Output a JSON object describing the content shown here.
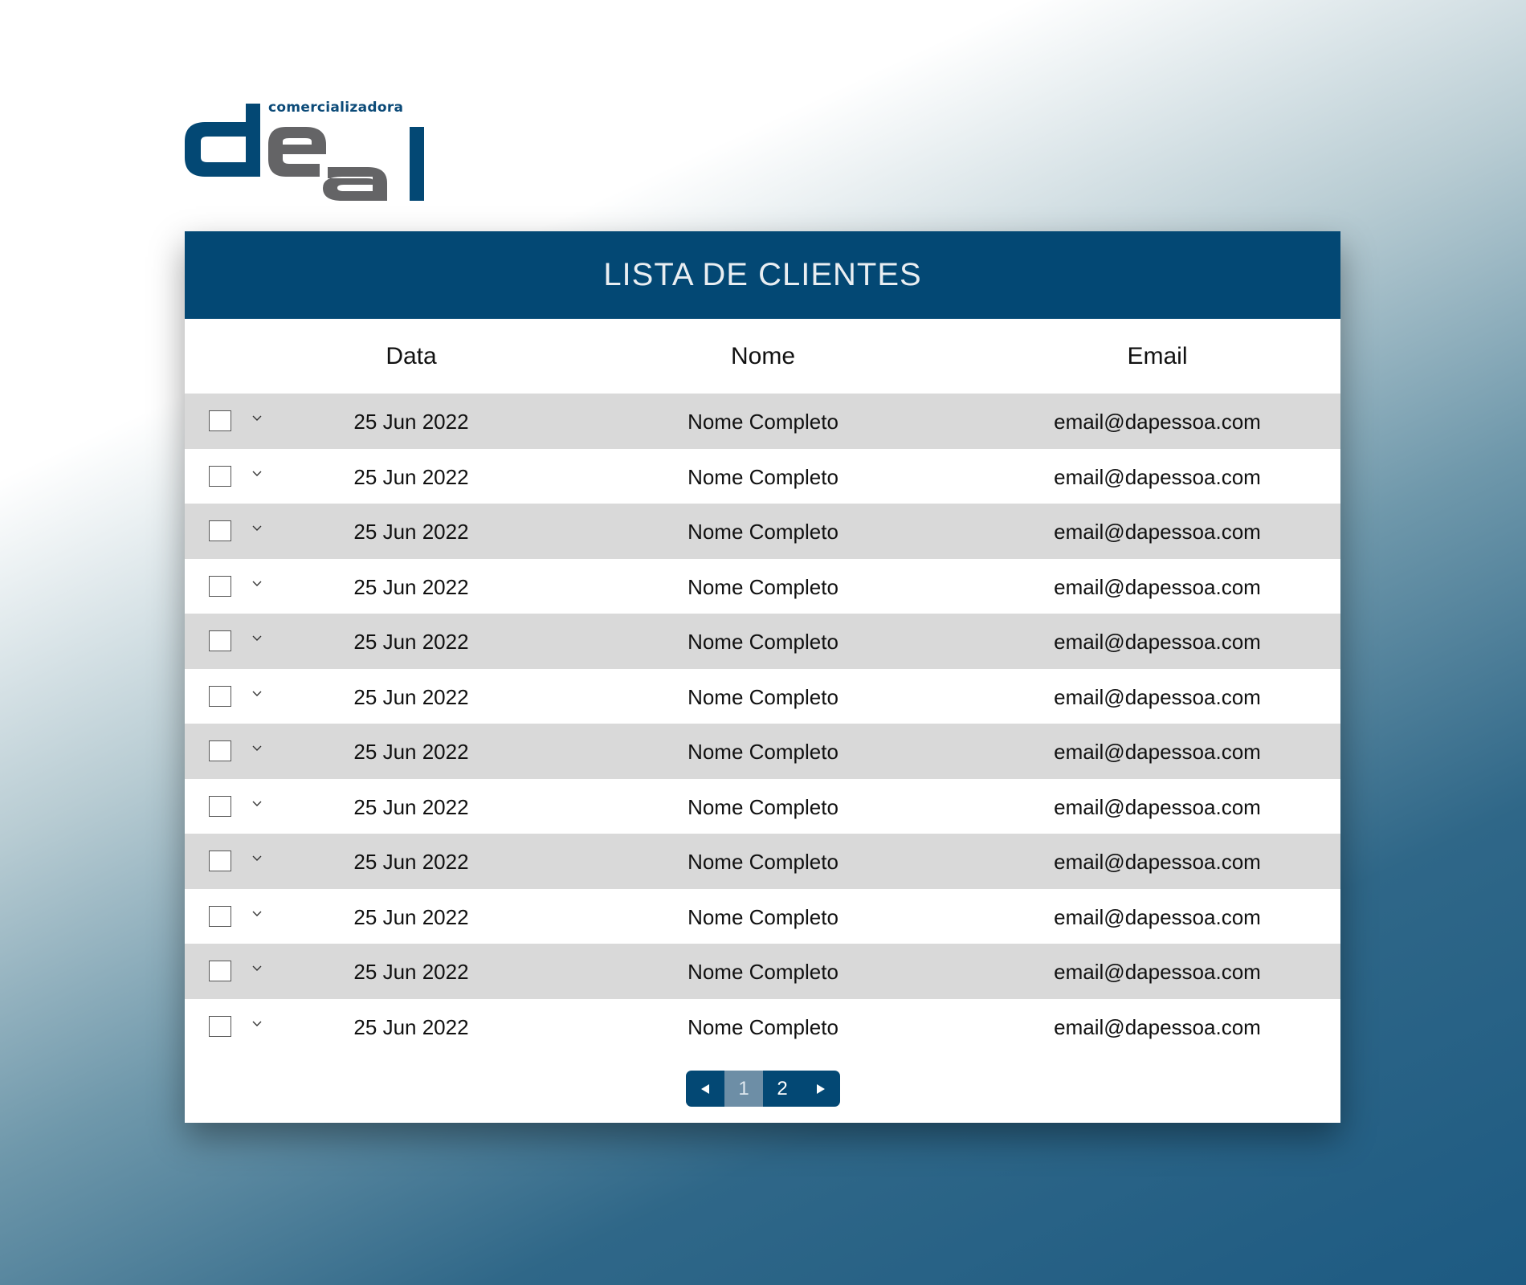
{
  "brand": {
    "tagline": "comercializadora",
    "wordmark": "deal",
    "colors": {
      "blue": "#034874",
      "gray": "#646466"
    }
  },
  "table": {
    "title": "LISTA DE CLIENTES",
    "columns": {
      "data": "Data",
      "nome": "Nome",
      "email": "Email"
    },
    "rows": [
      {
        "data": "25 Jun 2022",
        "nome": "Nome Completo",
        "email": "email@dapessoa.com",
        "checked": false
      },
      {
        "data": "25 Jun 2022",
        "nome": "Nome Completo",
        "email": "email@dapessoa.com",
        "checked": false
      },
      {
        "data": "25 Jun 2022",
        "nome": "Nome Completo",
        "email": "email@dapessoa.com",
        "checked": false
      },
      {
        "data": "25 Jun 2022",
        "nome": "Nome Completo",
        "email": "email@dapessoa.com",
        "checked": false
      },
      {
        "data": "25 Jun 2022",
        "nome": "Nome Completo",
        "email": "email@dapessoa.com",
        "checked": false
      },
      {
        "data": "25 Jun 2022",
        "nome": "Nome Completo",
        "email": "email@dapessoa.com",
        "checked": false
      },
      {
        "data": "25 Jun 2022",
        "nome": "Nome Completo",
        "email": "email@dapessoa.com",
        "checked": false
      },
      {
        "data": "25 Jun 2022",
        "nome": "Nome Completo",
        "email": "email@dapessoa.com",
        "checked": false
      },
      {
        "data": "25 Jun 2022",
        "nome": "Nome Completo",
        "email": "email@dapessoa.com",
        "checked": false
      },
      {
        "data": "25 Jun 2022",
        "nome": "Nome Completo",
        "email": "email@dapessoa.com",
        "checked": false
      },
      {
        "data": "25 Jun 2022",
        "nome": "Nome Completo",
        "email": "email@dapessoa.com",
        "checked": false
      },
      {
        "data": "25 Jun 2022",
        "nome": "Nome Completo",
        "email": "email@dapessoa.com",
        "checked": false
      }
    ]
  },
  "pagination": {
    "prev_icon": "triangle-left-icon",
    "pages": [
      "1",
      "2"
    ],
    "current": "1",
    "next_icon": "triangle-right-icon"
  },
  "colors": {
    "header_bg": "#034874",
    "row_alt_bg": "#d9d9d9",
    "active_page_bg": "#6d8ea6"
  }
}
